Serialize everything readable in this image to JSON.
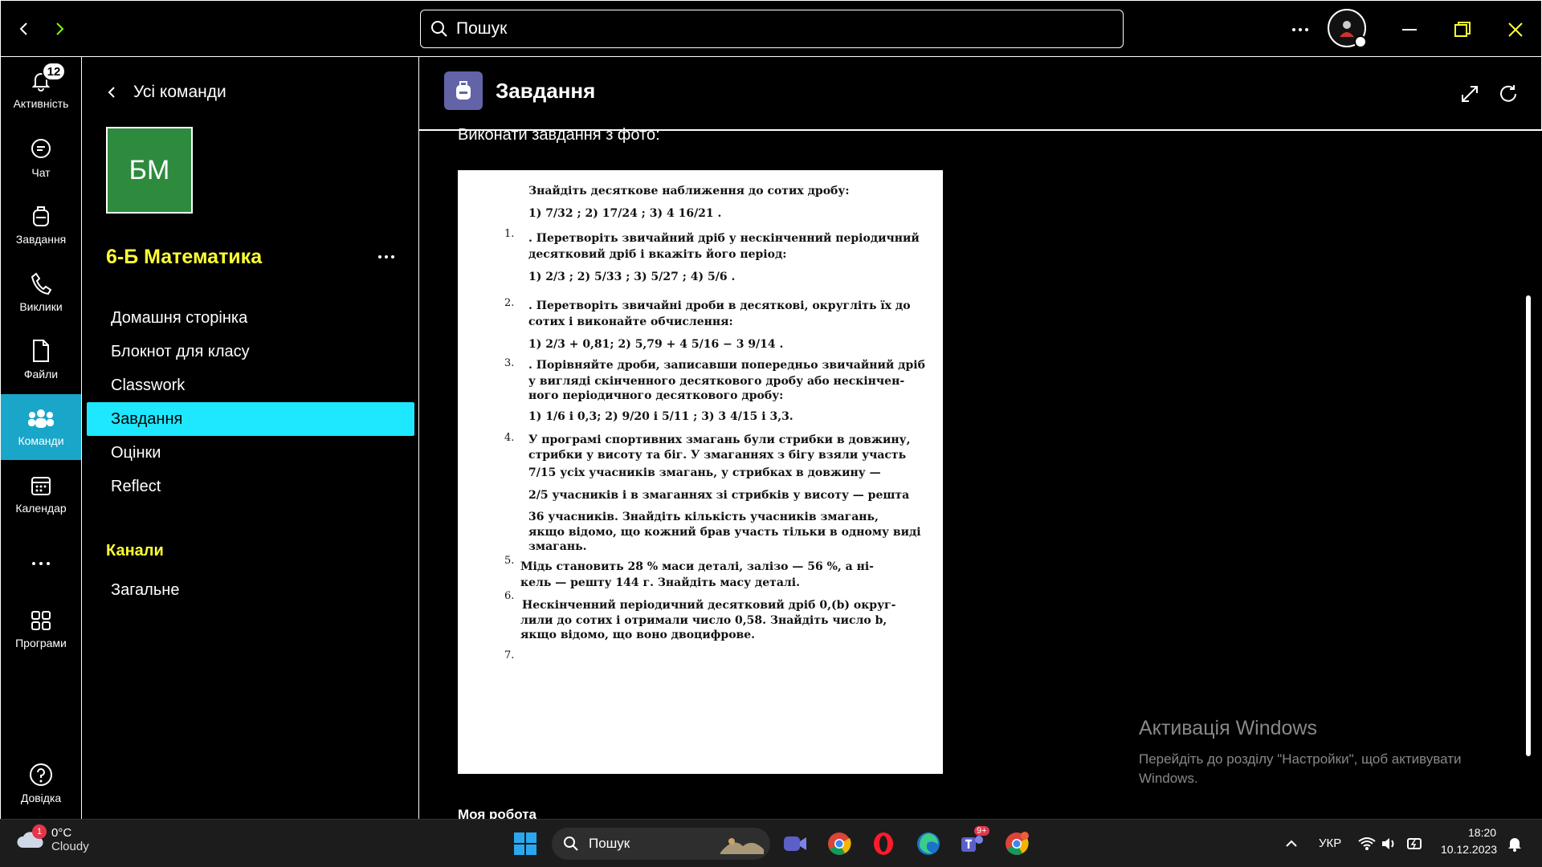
{
  "search": {
    "placeholder": "Пошук"
  },
  "rail": {
    "items": [
      {
        "label": "Активність",
        "badge": "12"
      },
      {
        "label": "Чат"
      },
      {
        "label": "Завдання"
      },
      {
        "label": "Виклики"
      },
      {
        "label": "Файли"
      },
      {
        "label": "Команди"
      },
      {
        "label": "Календар"
      },
      {
        "label": "Програми"
      },
      {
        "label": "Довідка"
      }
    ]
  },
  "team_panel": {
    "back_label": "Усі команди",
    "team_initials": "БМ",
    "team_name": "6-Б Математика",
    "menu": [
      "Домашня сторінка",
      "Блокнот для класу",
      "Classwork",
      "Завдання",
      "Оцінки",
      "Reflect"
    ],
    "channels_heading": "Канали",
    "channels": [
      "Загальне"
    ]
  },
  "main": {
    "title": "Завдання",
    "task_text": "Виконати завдання з фото:",
    "my_work": "Моя робота",
    "photo": {
      "numbers": [
        "1.",
        "2.",
        "3.",
        "4.",
        "5.",
        "6.",
        "7."
      ],
      "lines": [
        "Знайдіть десяткове наближення до сотих дробу:",
        "1) 7/32 ;          2) 17/24 ;          3) 4 16/21 .",
        ". Перетворіть звичайний дріб у нескінченний періодичний",
        "десятковий дріб і вкажіть його період:",
        "1) 2/3 ;        2) 5/33 ;        3) 5/27 ;        4) 5/6 .",
        ". Перетворіть звичайні дроби в десяткові, округліть їх до",
        "сотих і виконайте обчислення:",
        "1) 2/3 + 0,81;                     2) 5,79 + 4 5/16 − 3 9/14 .",
        ". Порівняйте дроби, записавши попередньо звичайний дріб",
        "у вигляді скінченного десяткового дробу або нескінчен-",
        "ного періодичного десяткового дробу:",
        "1) 1/6  і 0,3;            2) 9/20  і  5/11 ;          3) 3 4/15  і 3,3.",
        "У програмі спортивних змагань були стрибки в довжину,",
        "стрибки у висоту та біг. У змаганнях з бігу взяли участь",
        "7/15  усіх учасників змагань, у стрибках в довжину —",
        "2/5  учасників і в змаганнях зі стрибків у висоту — решта",
        "36 учасників. Знайдіть кількість учасників змагань,",
        "якщо відомо, що кожний брав участь тільки в одному виді",
        "змагань.",
        "Мідь становить 28 % маси деталі, залізо — 56 %, а ні-",
        "кель — решту 144 г. Знайдіть масу деталі.",
        "Нескінченний періодичний десятковий дріб 0,(b) округ-",
        "лили до сотих і отримали число 0,58. Знайдіть число b,",
        "якщо відомо, що воно двоцифрове."
      ]
    }
  },
  "watermark": {
    "title": "Активація Windows",
    "subtitle": "Перейдіть до розділу \"Настройки\", щоб активувати Windows."
  },
  "taskbar": {
    "weather_temp": "0°C",
    "weather_cond": "Cloudy",
    "weather_badge": "1",
    "search_label": "Пошук",
    "teams_badge": "9+",
    "language": "УКР",
    "time": "18:20",
    "date": "10.12.2023"
  }
}
